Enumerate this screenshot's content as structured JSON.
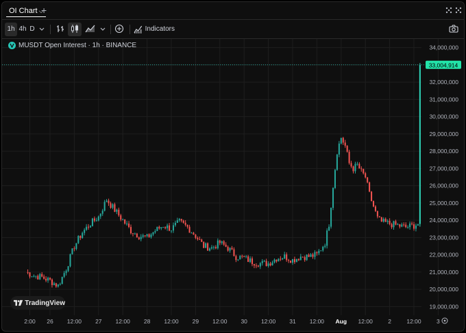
{
  "window": {
    "tab_label": "OI Chart",
    "tab_chevron_icon": "chevron-down-icon",
    "add_tab_icon": "plus-icon",
    "right_icons": [
      "grid-layout-icon",
      "more-dots-icon"
    ]
  },
  "toolbar": {
    "intervals": [
      "1h",
      "4h",
      "D"
    ],
    "active_interval": "1h",
    "interval_menu_icon": "chevron-down-icon",
    "bar_style_icon": "bars-icon",
    "candles_icon": "candles-icon",
    "area_icon": "area-chart-icon",
    "chart_type_menu_icon": "chevron-down-icon",
    "add_icon": "plus-circle-icon",
    "indicators_icon": "indicators-icon",
    "indicators_label": "Indicators",
    "screenshot_icon": "camera-icon"
  },
  "legend": {
    "symbol_icon": "exchange-logo-icon",
    "text": "MUSDT Open Interest · 1h · BINANCE"
  },
  "watermark": {
    "logo_icon": "tradingview-logo-icon",
    "text": "TradingView"
  },
  "settings_icon": "gear-icon",
  "colors": {
    "background": "#0f0f0f",
    "up": "#26a69a",
    "up_bright": "#2ed3b7",
    "down": "#ef5350",
    "grid": "#1e1e1e",
    "price_line": "#26a69a",
    "last_price_bg": "#22e3a8"
  },
  "chart_data": {
    "type": "candlestick",
    "title": "MUSDT Open Interest · 1h · BINANCE",
    "ylim": [
      18500000,
      34500000
    ],
    "y_ticks": [
      "34,000,000",
      "33,000,000",
      "32,000,000",
      "31,000,000",
      "30,000,000",
      "29,000,000",
      "28,000,000",
      "27,000,000",
      "26,000,000",
      "25,000,000",
      "24,000,000",
      "23,000,000",
      "22,000,000",
      "21,000,000",
      "20,000,000",
      "19,000,000"
    ],
    "y_tick_values": [
      34000000,
      33000000,
      32000000,
      31000000,
      30000000,
      29000000,
      28000000,
      27000000,
      26000000,
      25000000,
      24000000,
      23000000,
      22000000,
      21000000,
      20000000,
      19000000
    ],
    "x_ticks": [
      "2:00",
      "26",
      "12:00",
      "27",
      "12:00",
      "28",
      "12:00",
      "29",
      "12:00",
      "30",
      "12:00",
      "31",
      "12:00",
      "Aug",
      "12:00",
      "2",
      "12:00",
      "3"
    ],
    "x_tick_hours": [
      -10,
      0,
      12,
      24,
      36,
      48,
      60,
      72,
      84,
      96,
      108,
      120,
      132,
      144,
      156,
      168,
      180,
      192
    ],
    "x_tick_bold": [
      false,
      false,
      false,
      false,
      false,
      false,
      false,
      false,
      false,
      false,
      false,
      false,
      false,
      true,
      false,
      false,
      false,
      false
    ],
    "last_value": 33004914,
    "last_value_label": "33,004,914",
    "key_points": [
      [
        -12,
        21000000
      ],
      [
        -8,
        20800000
      ],
      [
        -4,
        20700000
      ],
      [
        0,
        20500000
      ],
      [
        4,
        20200000
      ],
      [
        8,
        21200000
      ],
      [
        12,
        22500000
      ],
      [
        16,
        23300000
      ],
      [
        20,
        23800000
      ],
      [
        24,
        24200000
      ],
      [
        28,
        25200000
      ],
      [
        32,
        24600000
      ],
      [
        36,
        24000000
      ],
      [
        40,
        23400000
      ],
      [
        44,
        23100000
      ],
      [
        48,
        23000000
      ],
      [
        52,
        23400000
      ],
      [
        56,
        23700000
      ],
      [
        60,
        23500000
      ],
      [
        64,
        23900000
      ],
      [
        68,
        23600000
      ],
      [
        72,
        23100000
      ],
      [
        76,
        22500000
      ],
      [
        80,
        22400000
      ],
      [
        84,
        22700000
      ],
      [
        88,
        22400000
      ],
      [
        92,
        21900000
      ],
      [
        96,
        21800000
      ],
      [
        100,
        21600000
      ],
      [
        104,
        21500000
      ],
      [
        108,
        21500000
      ],
      [
        112,
        21800000
      ],
      [
        116,
        21900000
      ],
      [
        120,
        21700000
      ],
      [
        124,
        21900000
      ],
      [
        128,
        21900000
      ],
      [
        132,
        22000000
      ],
      [
        136,
        22700000
      ],
      [
        138,
        23800000
      ],
      [
        140,
        26000000
      ],
      [
        142,
        28000000
      ],
      [
        144,
        28800000
      ],
      [
        146,
        28300000
      ],
      [
        148,
        27300000
      ],
      [
        150,
        27000000
      ],
      [
        152,
        27200000
      ],
      [
        154,
        26800000
      ],
      [
        156,
        26500000
      ],
      [
        158,
        25500000
      ],
      [
        160,
        24800000
      ],
      [
        162,
        24100000
      ],
      [
        164,
        23900000
      ],
      [
        168,
        23800000
      ],
      [
        172,
        23700000
      ],
      [
        176,
        23600000
      ],
      [
        180,
        23700000
      ],
      [
        182,
        23800000
      ],
      [
        183,
        33004914
      ]
    ]
  }
}
